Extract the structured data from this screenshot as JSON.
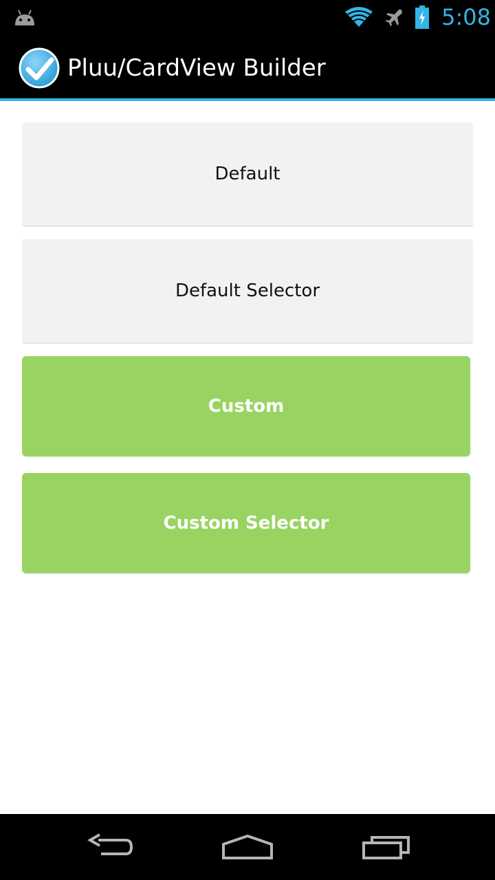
{
  "status_bar": {
    "time": "5:08",
    "icons": [
      "android-icon",
      "wifi-icon",
      "airplane-icon",
      "battery-charging-icon"
    ],
    "accent_color": "#33b5e5"
  },
  "action_bar": {
    "title": "Pluu/CardView Builder",
    "app_icon": "checkmark-icon",
    "accent_color": "#33b5e5"
  },
  "cards": [
    {
      "label": "Default",
      "style": "default",
      "color": "#f2f2f2"
    },
    {
      "label": "Default Selector",
      "style": "default",
      "color": "#f2f2f2"
    },
    {
      "label": "Custom",
      "style": "custom",
      "color": "#99d462"
    },
    {
      "label": "Custom Selector",
      "style": "custom",
      "color": "#99d462"
    }
  ],
  "nav_bar": {
    "buttons": [
      "back-icon",
      "home-icon",
      "recents-icon"
    ]
  }
}
